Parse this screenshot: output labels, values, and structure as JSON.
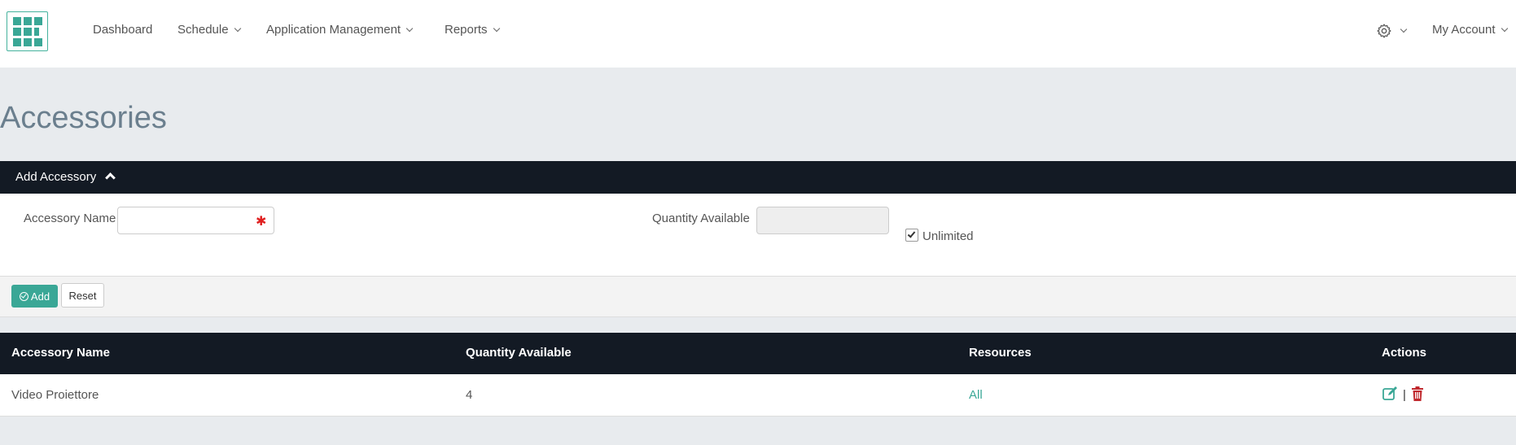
{
  "nav": {
    "items": [
      "Dashboard",
      "Schedule",
      "Application Management",
      "Reports"
    ],
    "account": "My Account"
  },
  "page": {
    "title": "Accessories"
  },
  "add_panel": {
    "title": "Add Accessory",
    "name_label": "Accessory Name",
    "name_value": "",
    "quantity_label": "Quantity Available",
    "quantity_value": "",
    "unlimited_label": "Unlimited",
    "unlimited_checked": true,
    "add_button": "Add",
    "reset_button": "Reset"
  },
  "table": {
    "columns": [
      "Accessory Name",
      "Quantity Available",
      "Resources",
      "Actions"
    ],
    "rows": [
      {
        "name": "Video Proiettore",
        "quantity": "4",
        "resources": "All"
      }
    ]
  },
  "colors": {
    "accent": "#3aa796",
    "header_bg": "#131a24",
    "delete": "#c0282d"
  },
  "icons": [
    "logo-grid-icon",
    "gear-icon",
    "chevron-down-icon",
    "chevron-up-icon",
    "ok-circle-icon",
    "edit-icon",
    "trash-icon"
  ]
}
